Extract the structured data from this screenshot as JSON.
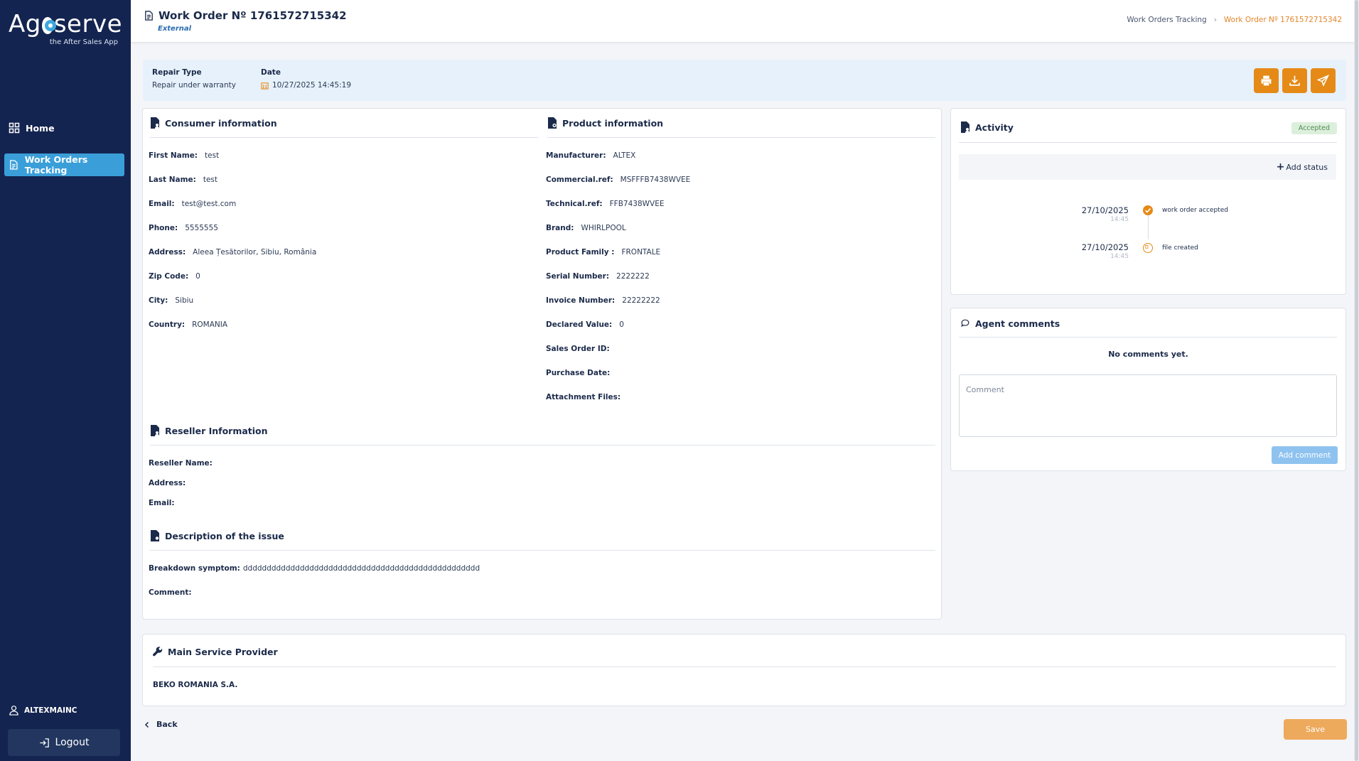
{
  "brand": {
    "name_left": "Ag",
    "name_right": "serve",
    "tagline": "the After Sales App"
  },
  "nav": {
    "home": "Home",
    "work_orders": "Work Orders Tracking"
  },
  "user": {
    "name": "ALTEXMAINC",
    "logout": "Logout"
  },
  "header": {
    "title": "Work Order Nº 1761572715342",
    "subtitle": "External",
    "breadcrumb": [
      "Work Orders Tracking",
      "Work Order Nº 1761572715342"
    ]
  },
  "band": {
    "repair_type_label": "Repair Type",
    "repair_type_value": "Repair under warranty",
    "date_label": "Date",
    "date_value": "10/27/2025 14:45:19"
  },
  "consumer": {
    "title": "Consumer information",
    "fields": [
      {
        "label": "First Name:",
        "value": "test"
      },
      {
        "label": "Last Name:",
        "value": "test"
      },
      {
        "label": "Email:",
        "value": "test@test.com"
      },
      {
        "label": "Phone:",
        "value": "5555555"
      },
      {
        "label": "Address:",
        "value": "Aleea Țesătorilor, Sibiu, România"
      },
      {
        "label": "Zip Code:",
        "value": "0"
      },
      {
        "label": "City:",
        "value": "Sibiu"
      },
      {
        "label": "Country:",
        "value": "ROMANIA"
      }
    ]
  },
  "product": {
    "title": "Product information",
    "fields": [
      {
        "label": "Manufacturer:",
        "value": "ALTEX"
      },
      {
        "label": "Commercial.ref:",
        "value": "MSFFFB7438WVEE"
      },
      {
        "label": "Technical.ref:",
        "value": "FFB7438WVEE"
      },
      {
        "label": "Brand:",
        "value": "WHIRLPOOL"
      },
      {
        "label": "Product Family :",
        "value": "FRONTALE"
      },
      {
        "label": "Serial Number:",
        "value": "2222222"
      },
      {
        "label": "Invoice Number:",
        "value": "22222222"
      },
      {
        "label": "Declared Value:",
        "value": "0"
      },
      {
        "label": "Sales Order ID:",
        "value": ""
      },
      {
        "label": "Purchase Date:",
        "value": ""
      },
      {
        "label": "Attachment Files:",
        "value": ""
      }
    ]
  },
  "reseller": {
    "title": "Reseller Information",
    "fields": [
      {
        "label": "Reseller Name:",
        "value": ""
      },
      {
        "label": "Address:",
        "value": ""
      },
      {
        "label": "Email:",
        "value": ""
      }
    ]
  },
  "issue": {
    "title": "Description of the issue",
    "fields": [
      {
        "label": "Breakdown symptom:",
        "value": "dddddddddddddddddddddddddddddddddddddddddddddddddd"
      },
      {
        "label": "Comment:",
        "value": ""
      }
    ]
  },
  "activity": {
    "title": "Activity",
    "status": "Accepted",
    "add_status": "Add status",
    "events": [
      {
        "date": "27/10/2025",
        "time": "14:45",
        "text": "work order accepted"
      },
      {
        "date": "27/10/2025",
        "time": "14:45",
        "text": "file created"
      }
    ],
    "colors": {
      "accent": "#e58a17"
    }
  },
  "comments": {
    "title": "Agent comments",
    "empty": "No comments yet.",
    "placeholder": "Comment",
    "add_button": "Add comment"
  },
  "provider": {
    "title": "Main Service Provider",
    "name": "BEKO ROMANIA S.A."
  },
  "footer": {
    "back": "Back",
    "save": "Save"
  }
}
